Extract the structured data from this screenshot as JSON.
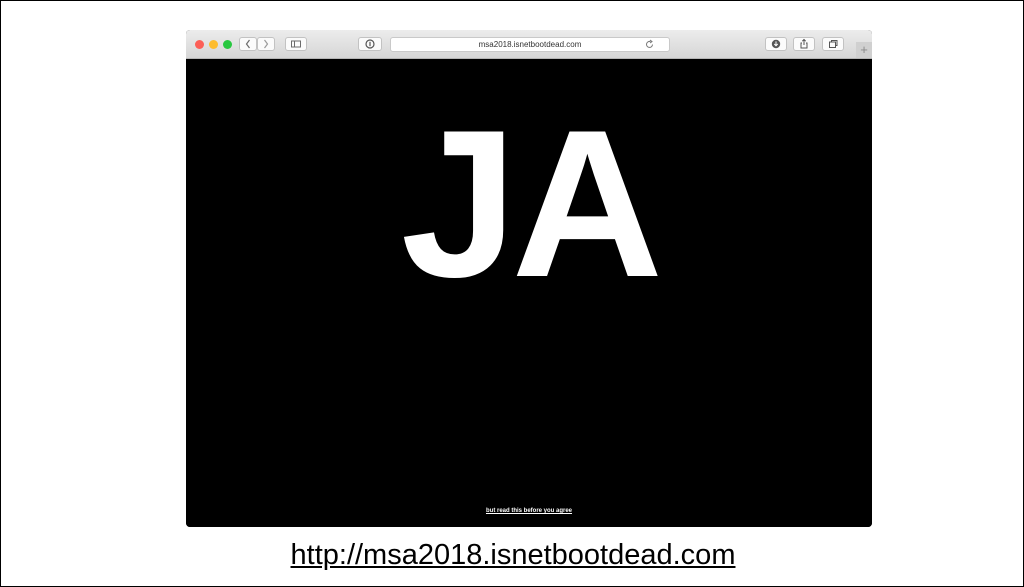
{
  "browser": {
    "url": "msa2018.isnetbootdead.com",
    "new_tab_label": "+",
    "traffic_colors": {
      "close": "#fc5f57",
      "minimize": "#fdbc2e",
      "zoom": "#28c840"
    }
  },
  "page": {
    "headline": "JA",
    "agree_link": "but read this before you agree"
  },
  "caption": {
    "url": "http://msa2018.isnetbootdead.com"
  }
}
